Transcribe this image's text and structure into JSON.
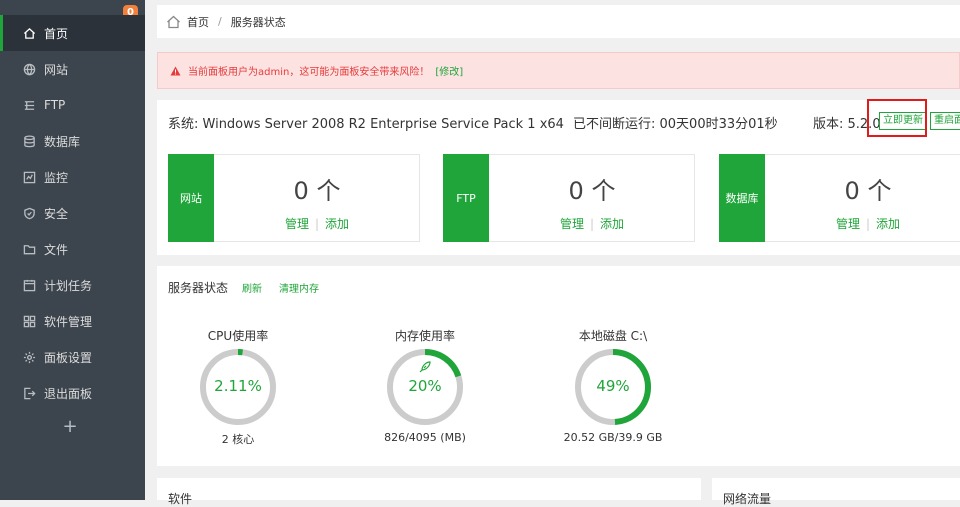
{
  "sidebar": {
    "badge": "0",
    "items": [
      {
        "label": "首页",
        "icon": "home-icon",
        "active": true
      },
      {
        "label": "网站",
        "icon": "globe-icon"
      },
      {
        "label": "FTP",
        "icon": "ftp-icon"
      },
      {
        "label": "数据库",
        "icon": "database-icon"
      },
      {
        "label": "监控",
        "icon": "monitor-icon"
      },
      {
        "label": "安全",
        "icon": "shield-icon"
      },
      {
        "label": "文件",
        "icon": "folder-icon"
      },
      {
        "label": "计划任务",
        "icon": "clock-icon"
      },
      {
        "label": "软件管理",
        "icon": "apps-icon"
      },
      {
        "label": "面板设置",
        "icon": "gear-icon"
      },
      {
        "label": "退出面板",
        "icon": "logout-icon"
      }
    ],
    "add_label": "+"
  },
  "breadcrumb": {
    "home": "首页",
    "separator": "/",
    "current": "服务器状态"
  },
  "alert": {
    "text": "当前面板用户为admin，这可能为面板安全带来风险！",
    "fix_link": "[修改]"
  },
  "system": {
    "os": "系统: Windows Server 2008 R2 Enterprise Service Pack 1 x64",
    "uptime": "已不间断运行: 00天00时33分01秒",
    "version": "版本: 5.2.0",
    "update_button": "立即更新",
    "restart_button": "重启面"
  },
  "stats": [
    {
      "tag": "网站",
      "count": "0 个",
      "manage": "管理",
      "add": "添加"
    },
    {
      "tag": "FTP",
      "count": "0 个",
      "manage": "管理",
      "add": "添加"
    },
    {
      "tag": "数据库",
      "count": "0 个",
      "manage": "管理",
      "add": "添加"
    }
  ],
  "server_status": {
    "title": "服务器状态",
    "refresh": "刷新",
    "clear_memory": "清理内存",
    "gauges": [
      {
        "title": "CPU使用率",
        "value": "2.11%",
        "sub": "2 核心",
        "percent": 2.11
      },
      {
        "title": "内存使用率",
        "value": "20%",
        "sub": "826/4095 (MB)",
        "percent": 20
      },
      {
        "title": "本地磁盘 C:\\",
        "value": "49%",
        "sub": "20.52 GB/39.9 GB",
        "percent": 49
      }
    ]
  },
  "bottom": {
    "software": "软件",
    "network": "网络流量"
  },
  "colors": {
    "accent": "#20a53a",
    "sidebar": "#3c444d",
    "alert": "#e63b3b"
  }
}
